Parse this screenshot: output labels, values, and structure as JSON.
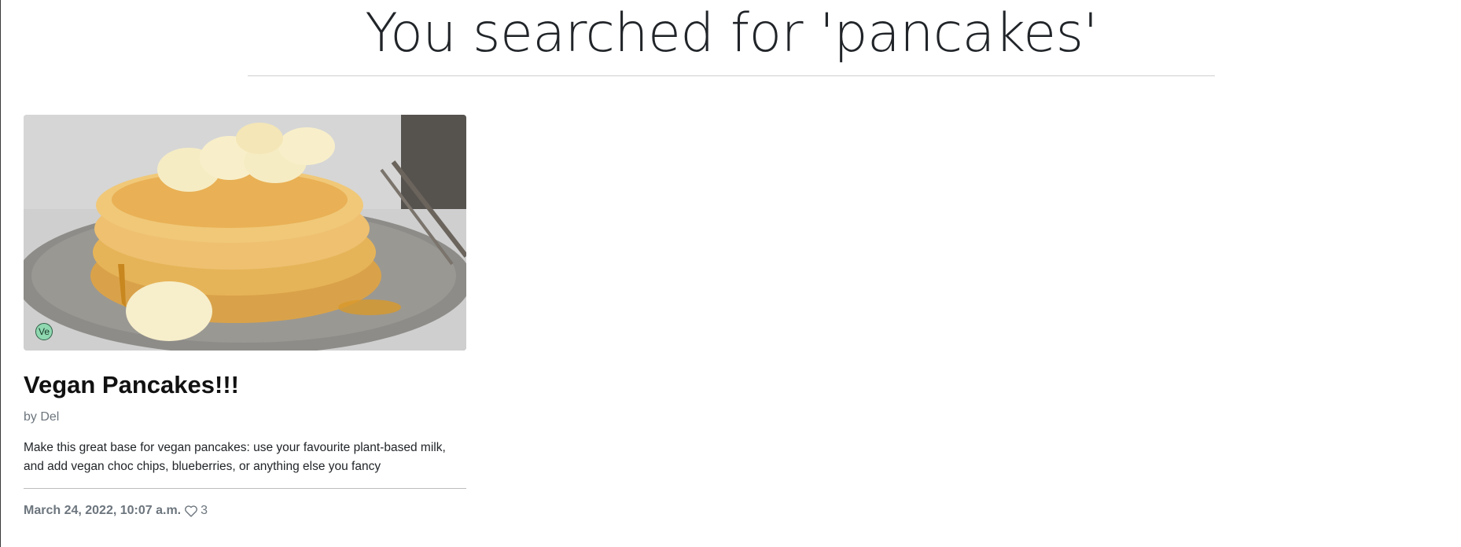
{
  "search": {
    "heading": "You searched for 'pancakes'"
  },
  "results": [
    {
      "title": "Vegan Pancakes!!!",
      "author": "by Del",
      "description": "Make this great base for vegan pancakes: use your favourite plant-based milk, and add vegan choc chips, blueberries, or anything else you fancy",
      "date": "March 24, 2022, 10:07 a.m.",
      "likes": "3",
      "diet_badge": "Ve",
      "diet_badge_color": "#8fd8b0",
      "image_icon": "pancake-stack-photo",
      "like_icon": "heart-outline-icon"
    }
  ]
}
